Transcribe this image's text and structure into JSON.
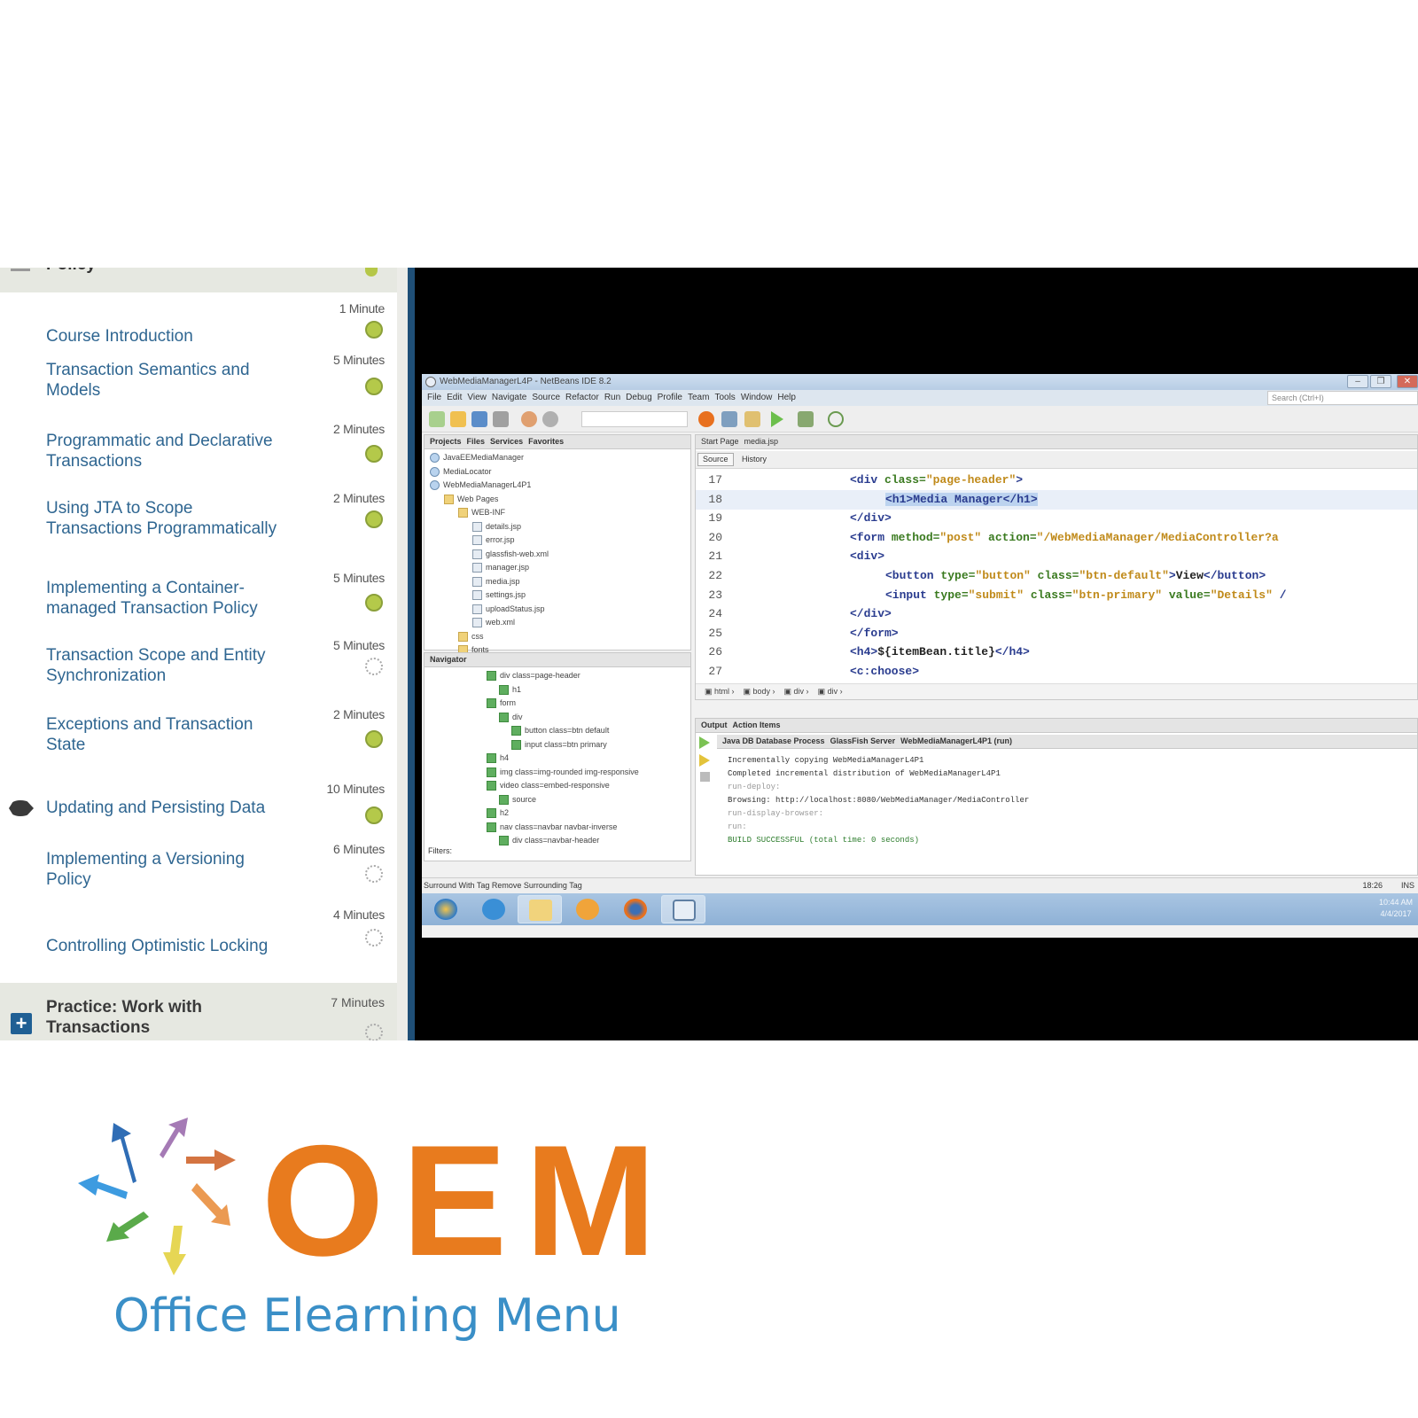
{
  "course_panel": {
    "top_section": {
      "title": "Policy"
    },
    "items": [
      {
        "title": "Course Introduction",
        "duration": "1 Minute",
        "status": "complete"
      },
      {
        "title": "Transaction Semantics and Models",
        "duration": "5 Minutes",
        "status": "complete"
      },
      {
        "title": "Programmatic and Declarative Transactions",
        "duration": "2 Minutes",
        "status": "complete"
      },
      {
        "title": "Using JTA to Scope Transactions Programmatically",
        "duration": "2 Minutes",
        "status": "complete"
      },
      {
        "title": "Implementing a Container-managed Transaction Policy",
        "duration": "5 Minutes",
        "status": "complete"
      },
      {
        "title": "Transaction Scope and Entity Synchronization",
        "duration": "5 Minutes",
        "status": "incomplete"
      },
      {
        "title": "Exceptions and Transaction State",
        "duration": "2 Minutes",
        "status": "complete"
      },
      {
        "title": "Updating and Persisting Data",
        "duration": "10 Minutes",
        "status": "complete",
        "current": true
      },
      {
        "title": "Implementing a Versioning Policy",
        "duration": "6 Minutes",
        "status": "incomplete"
      },
      {
        "title": "Controlling Optimistic Locking",
        "duration": "4 Minutes",
        "status": "incomplete"
      }
    ],
    "practice_section": {
      "title": "Practice: Work with Transactions",
      "duration": "7 Minutes",
      "status": "incomplete",
      "expand_icon": "plus-icon"
    }
  },
  "ide": {
    "window_title": "WebMediaManagerL4P - NetBeans IDE 8.2",
    "menu": [
      "File",
      "Edit",
      "View",
      "Navigate",
      "Source",
      "Refactor",
      "Run",
      "Debug",
      "Profile",
      "Team",
      "Tools",
      "Window",
      "Help"
    ],
    "search_placeholder": "Search (Ctrl+I)",
    "projects_tabs": [
      "Projects",
      "Files",
      "Services",
      "Favorites"
    ],
    "project_tree": [
      "JavaEEMediaManager",
      "MediaLocator",
      "WebMediaManagerL4P1",
      "Web Pages",
      "WEB-INF",
      "details.jsp",
      "error.jsp",
      "glassfish-web.xml",
      "manager.jsp",
      "media.jsp",
      "settings.jsp",
      "uploadStatus.jsp",
      "web.xml",
      "css",
      "fonts"
    ],
    "navigator": {
      "title": "Navigator",
      "items": [
        "div class=page-header",
        "h1",
        "form",
        "div",
        "button class=btn default",
        "input class=btn primary",
        "h4",
        "img class=img-rounded img-responsive",
        "video class=embed-responsive",
        "source",
        "h2",
        "nav class=navbar navbar-inverse",
        "div class=navbar-header"
      ],
      "filters_label": "Filters:"
    },
    "editor_tabs": [
      "Start Page",
      "media.jsp"
    ],
    "editor_modes": [
      "Source",
      "History"
    ],
    "code_lines": [
      {
        "n": "17",
        "parts": [
          [
            "tag",
            "<div "
          ],
          [
            "attr",
            "class="
          ],
          [
            "str",
            "\"page-header\""
          ],
          [
            "tag",
            ">"
          ]
        ],
        "indent": 0
      },
      {
        "n": "18",
        "parts": [
          [
            "selected",
            "<h1>Media Manager</h1>"
          ]
        ],
        "indent": 1,
        "highlight": true
      },
      {
        "n": "19",
        "parts": [
          [
            "tag",
            "</div>"
          ]
        ],
        "indent": 0
      },
      {
        "n": "20",
        "parts": [
          [
            "tag",
            "<form "
          ],
          [
            "attr",
            "method="
          ],
          [
            "str",
            "\"post\" "
          ],
          [
            "attr",
            "action="
          ],
          [
            "str",
            "\"/WebMediaManager/MediaController?a"
          ]
        ],
        "indent": 0
      },
      {
        "n": "21",
        "parts": [
          [
            "tag",
            "<div>"
          ]
        ],
        "indent": 0
      },
      {
        "n": "22",
        "parts": [
          [
            "tag",
            "<button "
          ],
          [
            "attr",
            "type="
          ],
          [
            "str",
            "\"button\" "
          ],
          [
            "attr",
            "class="
          ],
          [
            "str",
            "\"btn-default\""
          ],
          [
            "tag",
            ">"
          ],
          [
            "txt",
            "View"
          ],
          [
            "tag",
            "</button>"
          ]
        ],
        "indent": 1
      },
      {
        "n": "23",
        "parts": [
          [
            "tag",
            "<input "
          ],
          [
            "attr",
            "type="
          ],
          [
            "str",
            "\"submit\" "
          ],
          [
            "attr",
            "class="
          ],
          [
            "str",
            "\"btn-primary\" "
          ],
          [
            "attr",
            "value="
          ],
          [
            "str",
            "\"Details\" "
          ],
          [
            "tag",
            "/"
          ]
        ],
        "indent": 1
      },
      {
        "n": "24",
        "parts": [
          [
            "tag",
            "</div>"
          ]
        ],
        "indent": 0
      },
      {
        "n": "25",
        "parts": [
          [
            "tag",
            "</form>"
          ]
        ],
        "indent": 0
      },
      {
        "n": "26",
        "parts": [
          [
            "tag",
            "<h4>"
          ],
          [
            "txt",
            "${itemBean.title}"
          ],
          [
            "tag",
            "</h4>"
          ]
        ],
        "indent": 0
      },
      {
        "n": "27",
        "parts": [
          [
            "tag",
            "<c:choose>"
          ]
        ],
        "indent": 0
      }
    ],
    "breadcrumb": [
      "html",
      "body",
      "div",
      "div"
    ],
    "output_tabs": [
      "Output",
      "Action Items"
    ],
    "output_subtabs": [
      "Java DB Database Process",
      "GlassFish Server",
      "WebMediaManagerL4P1 (run)"
    ],
    "output_lines": [
      {
        "text": "Incrementally copying WebMediaManagerL4P1",
        "style": "normal"
      },
      {
        "text": "Completed incremental distribution of WebMediaManagerL4P1",
        "style": "normal"
      },
      {
        "text": "run-deploy:",
        "style": "dim"
      },
      {
        "text": "Browsing: http://localhost:8080/WebMediaManager/MediaController",
        "style": "normal"
      },
      {
        "text": "run-display-browser:",
        "style": "dim"
      },
      {
        "text": "run:",
        "style": "dim"
      },
      {
        "text": "BUILD SUCCESSFUL (total time: 0 seconds)",
        "style": "ok"
      }
    ],
    "status_left": "Surround With Tag  Remove Surrounding Tag",
    "cursor_position": "18:26",
    "insert_mode": "INS",
    "clock_time": "10:44 AM",
    "clock_date": "4/4/2017"
  },
  "logo": {
    "text": "OEM",
    "subtitle": "Office Elearning Menu",
    "colors": {
      "orange": "#e87b1e",
      "blue": "#3a8fc7"
    }
  }
}
